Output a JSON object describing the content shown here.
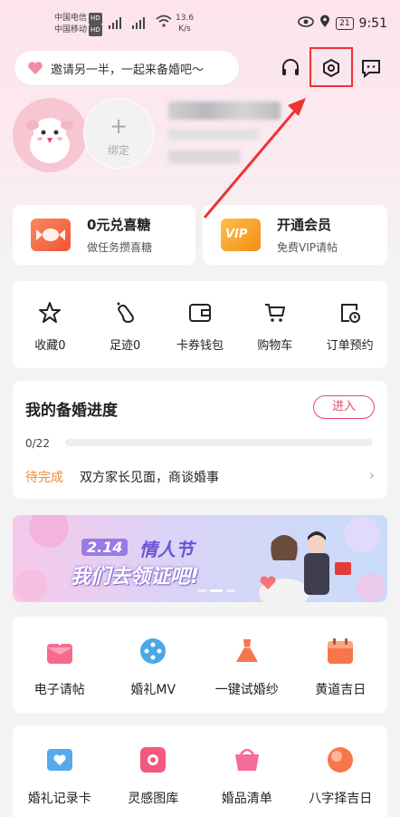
{
  "status_bar": {
    "carrier1": "中国电信",
    "carrier2": "中国移动",
    "hd": "HD",
    "speed_value": "13.6",
    "speed_unit": "K/s",
    "battery": "21",
    "time": "9:51"
  },
  "invite": {
    "text": "邀请另一半，一起来备婚吧～"
  },
  "profile": {
    "bind_plus": "+",
    "bind_label": "绑定"
  },
  "promo_cards": [
    {
      "title": "0元兑喜糖",
      "subtitle": "做任务攒喜糖",
      "icon": "candy-icon",
      "color": "#f46a3c"
    },
    {
      "title": "开通会员",
      "subtitle": "免费VIP请帖",
      "icon": "vip-icon",
      "color": "#f6a21c",
      "badge": "VIP"
    }
  ],
  "quick_actions": [
    {
      "label": "收藏0",
      "icon": "star-icon"
    },
    {
      "label": "足迹0",
      "icon": "footprint-icon"
    },
    {
      "label": "卡券钱包",
      "icon": "wallet-icon"
    },
    {
      "label": "购物车",
      "icon": "cart-icon"
    },
    {
      "label": "订单预约",
      "icon": "order-icon"
    }
  ],
  "progress": {
    "title": "我的备婚进度",
    "enter_label": "进入",
    "fraction": "0/22",
    "value": 0,
    "pending_label": "待完成",
    "pending_text": "双方家长见面，商谈婚事"
  },
  "banner": {
    "date": "2.14",
    "title": "情人节",
    "slogan": "我们去领证吧!"
  },
  "tools_row1": [
    {
      "label": "电子请帖",
      "icon": "invitation-icon",
      "color": "#f56b8e"
    },
    {
      "label": "婚礼MV",
      "icon": "film-icon",
      "color": "#4aa8e6"
    },
    {
      "label": "一键试婚纱",
      "icon": "dress-icon",
      "color": "#f5774b"
    },
    {
      "label": "黄道吉日",
      "icon": "calendar-icon",
      "color": "#f5774b"
    }
  ],
  "tools_row2": [
    {
      "label": "婚礼记录卡",
      "icon": "heart-card-icon",
      "color": "#56a9ec"
    },
    {
      "label": "灵感图库",
      "icon": "gallery-icon",
      "color": "#f5587c"
    },
    {
      "label": "婚品清单",
      "icon": "basket-icon",
      "color": "#f56b9c"
    },
    {
      "label": "八字择吉日",
      "icon": "moon-icon",
      "color": "#f5774b"
    }
  ],
  "colors": {
    "accent": "#e8466e",
    "pending": "#f08a2c",
    "highlight_box": "#e33333"
  }
}
